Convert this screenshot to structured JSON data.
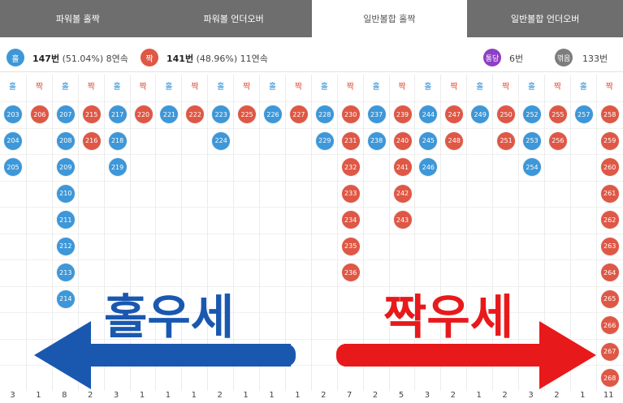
{
  "tabs": [
    {
      "label": "파워볼 홀짝",
      "active": false
    },
    {
      "label": "파워볼 언더오버",
      "active": false
    },
    {
      "label": "일반볼합 홀짝",
      "active": true
    },
    {
      "label": "일반볼합 언더오버",
      "active": false
    }
  ],
  "stats": {
    "odd_badge": "홀",
    "odd_count": "147번",
    "odd_detail": "(51.04%) 8연속",
    "even_badge": "짝",
    "even_count": "141번",
    "even_detail": "(48.96%) 11연속",
    "tie_badge": "통당",
    "tie_value": "6번",
    "stuck_badge": "꺾음",
    "stuck_value": "133번"
  },
  "colors": {
    "odd": "#3d97d8",
    "even": "#df5745",
    "tie": "#8e3fc5",
    "stuck": "#7d7d7d"
  },
  "columns": [
    {
      "type": "odd",
      "header": "홀",
      "balls": [
        "203",
        "204",
        "205"
      ],
      "count": "3"
    },
    {
      "type": "even",
      "header": "짝",
      "balls": [
        "206"
      ],
      "count": "1"
    },
    {
      "type": "odd",
      "header": "홀",
      "balls": [
        "207",
        "208",
        "209",
        "210",
        "211",
        "212",
        "213",
        "214"
      ],
      "count": "8"
    },
    {
      "type": "even",
      "header": "짝",
      "balls": [
        "215",
        "216"
      ],
      "count": "2"
    },
    {
      "type": "odd",
      "header": "홀",
      "balls": [
        "217",
        "218",
        "219"
      ],
      "count": "3"
    },
    {
      "type": "even",
      "header": "짝",
      "balls": [
        "220"
      ],
      "count": "1"
    },
    {
      "type": "odd",
      "header": "홀",
      "balls": [
        "221"
      ],
      "count": "1"
    },
    {
      "type": "even",
      "header": "짝",
      "balls": [
        "222"
      ],
      "count": "1"
    },
    {
      "type": "odd",
      "header": "홀",
      "balls": [
        "223",
        "224"
      ],
      "count": "2"
    },
    {
      "type": "even",
      "header": "짝",
      "balls": [
        "225"
      ],
      "count": "1"
    },
    {
      "type": "odd",
      "header": "홀",
      "balls": [
        "226"
      ],
      "count": "1"
    },
    {
      "type": "even",
      "header": "짝",
      "balls": [
        "227"
      ],
      "count": "1"
    },
    {
      "type": "odd",
      "header": "홀",
      "balls": [
        "228",
        "229"
      ],
      "count": "2"
    },
    {
      "type": "even",
      "header": "짝",
      "balls": [
        "230",
        "231",
        "232",
        "233",
        "234",
        "235",
        "236"
      ],
      "count": "7"
    },
    {
      "type": "odd",
      "header": "홀",
      "balls": [
        "237",
        "238"
      ],
      "count": "2"
    },
    {
      "type": "even",
      "header": "짝",
      "balls": [
        "239",
        "240",
        "241",
        "242",
        "243"
      ],
      "count": "5"
    },
    {
      "type": "odd",
      "header": "홀",
      "balls": [
        "244",
        "245",
        "246"
      ],
      "count": "3"
    },
    {
      "type": "even",
      "header": "짝",
      "balls": [
        "247",
        "248"
      ],
      "count": "2"
    },
    {
      "type": "odd",
      "header": "홀",
      "balls": [
        "249"
      ],
      "count": "1"
    },
    {
      "type": "even",
      "header": "짝",
      "balls": [
        "250",
        "251"
      ],
      "count": "2"
    },
    {
      "type": "odd",
      "header": "홀",
      "balls": [
        "252",
        "253",
        "254"
      ],
      "count": "3"
    },
    {
      "type": "even",
      "header": "짝",
      "balls": [
        "255",
        "256"
      ],
      "count": "2"
    },
    {
      "type": "odd",
      "header": "홀",
      "balls": [
        "257"
      ],
      "count": "1"
    },
    {
      "type": "even",
      "header": "짝",
      "balls": [
        "258",
        "259",
        "260",
        "261",
        "262",
        "263",
        "264",
        "265",
        "266",
        "267",
        "268"
      ],
      "count": "11"
    }
  ],
  "overlay": {
    "left_text": "홀우세",
    "right_text": "짝우세",
    "left_color": "#1a58b0",
    "right_color": "#e8191b"
  }
}
